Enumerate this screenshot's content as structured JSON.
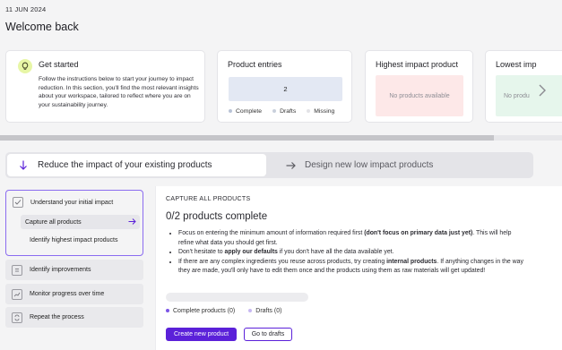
{
  "header": {
    "date": "11 JUN 2024",
    "welcome": "Welcome back"
  },
  "cards": {
    "get_started": {
      "title": "Get started",
      "description": "Follow the instructions below to start your journey to impact reduction. In this section, you'll find the most relevant insights about your workspace, tailored to reflect where you are on your sustainability journey.",
      "icon": "lightbulb-icon"
    },
    "product_entries": {
      "title": "Product entries",
      "count": "2",
      "legend": [
        {
          "label": "Complete",
          "color": "#b9c3d6"
        },
        {
          "label": "Drafts",
          "color": "#c9d0dc"
        },
        {
          "label": "Missing",
          "color": "#e2e2e6"
        }
      ]
    },
    "highest": {
      "title": "Highest impact product",
      "empty": "No products available",
      "bg": "#fde8e8"
    },
    "lowest": {
      "title": "Lowest imp",
      "empty": "No produ",
      "bg": "#e6f6ec"
    }
  },
  "tabs": [
    {
      "label": "Reduce the impact of your existing products",
      "icon": "arrow-down-icon"
    },
    {
      "label": "Design new low impact products",
      "icon": "arrow-right-icon"
    }
  ],
  "sidebar": {
    "group": {
      "label": "Understand your initial impact",
      "items": [
        "Capture all products",
        "Identify highest impact products"
      ]
    },
    "items": [
      {
        "label": "Identify improvements",
        "icon": "list-icon"
      },
      {
        "label": "Monitor progress over time",
        "icon": "chart-icon"
      },
      {
        "label": "Repeat the process",
        "icon": "repeat-icon"
      }
    ]
  },
  "main": {
    "section_label": "CAPTURE ALL PRODUCTS",
    "progress_title": "0/2 products complete",
    "bullets": [
      {
        "pre": "Focus on entering the minimum amount of information required first ",
        "bold": "(don't focus on primary data just yet)",
        "post": ". This will help refine what data you should get first."
      },
      {
        "pre": "Don't hesitate to ",
        "bold": "apply our defaults",
        "post": " if you don't have all the data available yet."
      },
      {
        "pre": "If there are any complex ingredients you reuse across products, try creating ",
        "bold": "internal products",
        "post": ". If anything changes in the way they are made, you'll only have to edit them once and the products using them as raw materials will get updated!"
      }
    ],
    "progress_fraction": 0,
    "legend": [
      {
        "label": "Complete products (0)",
        "color": "#7b55e6"
      },
      {
        "label": "Drafts (0)",
        "color": "#c7b8f2"
      }
    ],
    "primary_button": "Create new product",
    "secondary_button": "Go to drafts",
    "accent": "#5b21d9"
  }
}
